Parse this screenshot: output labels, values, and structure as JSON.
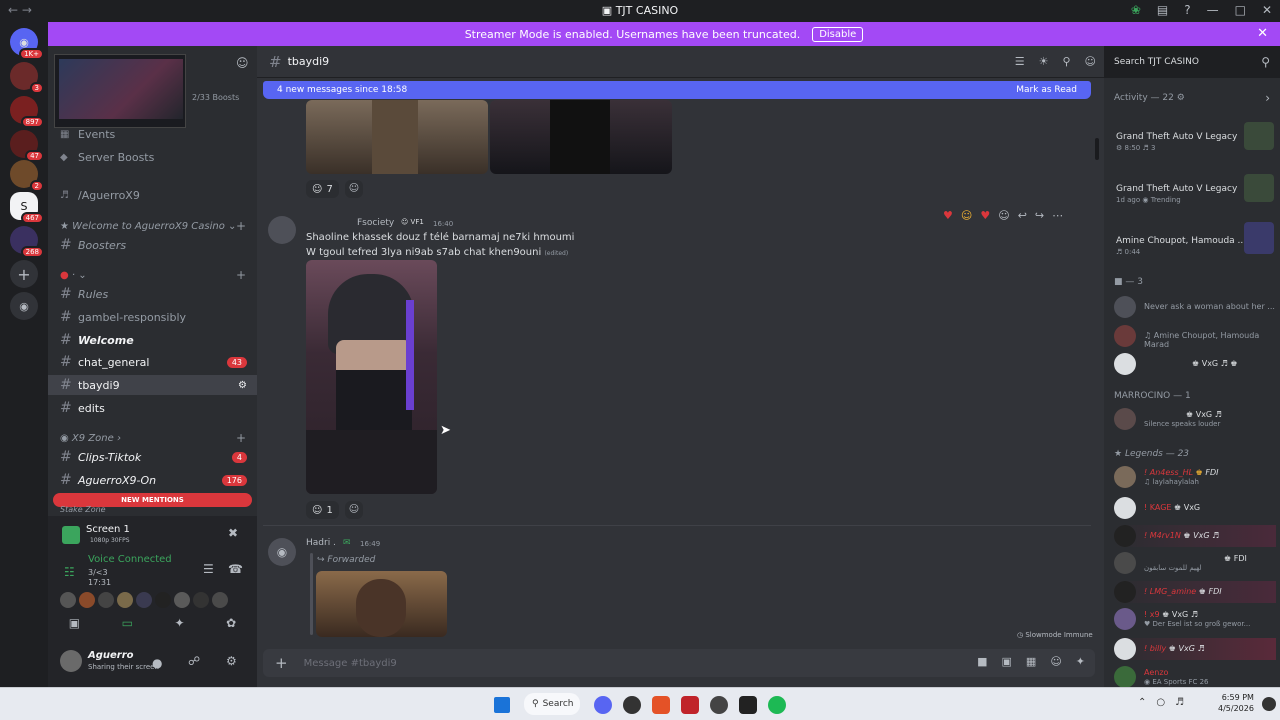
{
  "window": {
    "title": "TJT CASINO",
    "logo": "discord-logo-icon"
  },
  "banner": {
    "text": "Streamer Mode is enabled. Usernames have been truncated.",
    "button": "Disable"
  },
  "server_badges": {
    "home": "1K+",
    "s1": "3",
    "s2": "897",
    "s3": "47",
    "s4": "2",
    "s5": "467",
    "s6": "268"
  },
  "sidebar": {
    "boosts": "2/33 Boosts",
    "events": "Events",
    "server_boosts": "Server Boosts",
    "voice_channel": "/AguerroX9",
    "category1": "Welcome to AguerroX9 Casino",
    "ch_boosters": "Boosters",
    "category2": "·",
    "ch_rules": "Rules",
    "ch_gamble": "gambel-responsibly",
    "ch_welcome": "Welcome",
    "ch_general": "chat_general",
    "general_badge": "43",
    "ch_tbaydi": "tbaydi9",
    "ch_edits": "edits",
    "category3": "X9 Zone",
    "ch_clips": "Clips-Tiktok",
    "clips_badge": "4",
    "ch_aguerro": "AguerroX9-On",
    "aguerro_badge": "176",
    "new_mentions": "NEW MENTIONS",
    "stake_zone": "Stake Zone"
  },
  "voice": {
    "screen_title": "Screen 1",
    "screen_sub": "1080p 30FPS",
    "connected": "Voice Connected",
    "channel": "3/<3",
    "time": "17:31",
    "user": "Aguerro",
    "user_status": "Sharing their screen"
  },
  "channel_header": {
    "name": "tbaydi9"
  },
  "new_messages": {
    "text": "4 new messages since 18:58",
    "action": "Mark as Read"
  },
  "messages": {
    "react1_count": "7",
    "msg2_author": "Fsociety",
    "msg2_tag": "VF1",
    "msg2_time": "16:40",
    "msg2_line1": "Shaoline  khassek douz f télé barnamaj ne7ki hmoumi",
    "msg2_line2": "W tgoul tefred 3lya ni9ab s7ab chat khen9ouni",
    "msg2_edited": "(edited)",
    "react2_count": "1",
    "msg3_author": "Hadri .",
    "msg3_time": "16:49",
    "msg3_forwarded": "Forwarded",
    "slowmode": "Slowmode Immune"
  },
  "composer": {
    "placeholder": "Message #tbaydi9"
  },
  "members": {
    "search_placeholder": "Search TJT CASINO",
    "activity_title": "Activity — 22",
    "act1_game": "Grand Theft Auto V Legacy",
    "act1_meta": "8:50",
    "act1_count": "3",
    "act2_game": "Grand Theft Auto V Legacy",
    "act2_meta": "1d ago",
    "act2_extra": "Trending",
    "act3_title": "Amine Choupot, Hamouda ...",
    "act3_meta": "0:44",
    "group1": "3",
    "m1_status": "Never ask a woman about her ...",
    "m2_status": "Amine Choupot, Hamouda Marad",
    "m3_tag": "VxG",
    "group2": "MARROCINO — 1",
    "m4_tag": "VxG",
    "m4_status": "Silence speaks louder",
    "group3": "Legends — 23",
    "l1_name": "! An4ess_HL",
    "l1_tag": "FDI",
    "l1_status": "laylahaylalah",
    "l2_name": "! KAGE",
    "l2_tag": "VxG",
    "l3_name": "! M4rv1N",
    "l3_tag": "VxG",
    "l4_tag": "FDI",
    "l4_status": "لهيم للموت سابقون",
    "l5_name": "! LMG_amine",
    "l5_tag": "FDI",
    "l6_name": "! x9",
    "l6_tag": "VxG",
    "l6_status": "Der Esel ist so groß gewor...",
    "l7_name": "! billy",
    "l7_tag": "VxG",
    "l8_name": "Aenzo",
    "l8_status": "EA Sports FC 26"
  },
  "taskbar": {
    "search": "Search",
    "time": "6:59 PM",
    "date": "4/5/2026"
  }
}
